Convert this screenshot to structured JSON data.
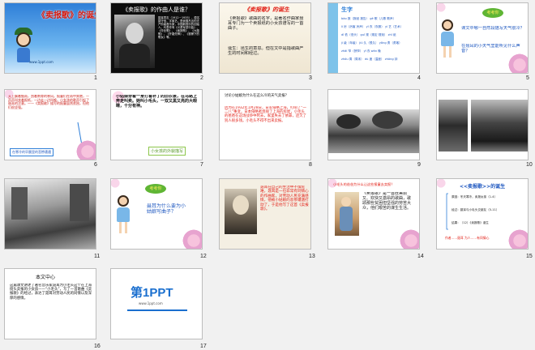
{
  "slides": [
    {
      "number": "1",
      "title": "《卖报歌》的诞生",
      "footer": "www.1ppt.com"
    },
    {
      "number": "2",
      "title": "《卖报歌》的作曲人是谁？",
      "text": "聂耳同志（1912－1935），原名聂守信，字紫艺。是我国杰出的无产阶级音乐家，中国新音乐的创始人。代表作有《义勇军进行曲》、《毕业歌》、《卖报歌》、《大路歌》、《开路先锋》、《铁蹄下的歌女》等。"
    },
    {
      "number": "3",
      "title": "《卖报歌》的诞生",
      "lines": [
        "《卖报歌》歌曲的名字，是著名作曲家聂耳专门为一个卖报纸的小女孩谱写的一首曲子。",
        "诞生：出生的意思。但在文中是指歌曲产生的时间和经过。"
      ]
    },
    {
      "number": "4",
      "title": "生字",
      "rows": [
        "bào 报（报纸 报告）  gē 歌（儿歌 歌声）",
        "lì 厉（厉害 厉声）  yī 衣（衣服）  yì 艺（艺术）",
        "dī 低（低头）  guī 规（规定 规矩）  zhǐ 纸",
        "jí 级（年级）  jiǔ 久（很久）  yǒng 勇（勇敢）",
        "zhāi 窄（狭窄）  yī 衣  wǎn 晚",
        "zhōu 周（周末）  dù 度（温度）  zhōng 钟"
      ]
    },
    {
      "number": "5",
      "bubble": "考考你",
      "lines": [
        "课文中哪一自然段描写天气很冷？",
        "在聂耳的小天气里能听见什么声音？"
      ]
    },
    {
      "number": "6",
      "text": "天上飘着细雨，刮着刺骨的寒风。报童们在雨中奔跑，一声声叫卖着报纸，一边走一边叫唤。小女孩的歌声引起了聂耳的注意。——《卖报歌》描写的报童虽然贫困，但他们很坚强。",
      "footer": "在寒冷的早晨里的悲惨遭遇"
    },
    {
      "number": "7",
      "text": "小姑娘穿着一身打着补丁的旧衣裳，在马路上奔走叫卖。她叫小毛头，一双又黑又亮的大眼睛，十分有神。",
      "footer": "小女孩的外貌描写"
    },
    {
      "number": "8",
      "question": "讨论小姑娘为什么在这么冷的天气卖报？",
      "text": "因为在1932年1月28日，日军侵略上海，打响了“一二八”事变，日本侵略者烧毁了上海的房屋，小毛头的爸爸在这场战争中死去，家里失去了依靠，还欠了别人很多钱。小毛头不得不出来卖报。"
    },
    {
      "number": "9"
    },
    {
      "number": "10"
    },
    {
      "number": "11"
    },
    {
      "number": "12",
      "bubble": "考考你",
      "text": "聂耳为什么要为小姑娘写曲子？"
    },
    {
      "number": "13",
      "text": "聂耳在自己的生活中不惧危难，聂耳是一位非常有同情心的作曲家，对劳动人民充满感情，他被小姑娘的悲惨遭遇打动了，于是他写了这首《卖报歌》。"
    },
    {
      "number": "14",
      "question": "小毛头的爸爸为什么让这些报童去卖报？",
      "text": "《卖报歌》是一首既美丽又、欢快又激昂的歌曲，歌颂那些贫困但坚强的劳苦大众，他们艰苦的谋生生活。"
    },
    {
      "number": "15",
      "title": "<<卖报歌>>的诞生",
      "rows": [
        "原因：冬天寒冷，卖报女孩（1-4）",
        "经过：聂耳与小毛头交朋友（5-11）",
        "结果：（12）《卖报歌》诞生",
        "作者……聂耳  为人……有同情心"
      ]
    },
    {
      "number": "16",
      "title": "本文中心",
      "text": "这篇课文讲述了著名音乐家聂耳为小毛头这个在上海街头卖报的小女孩——“小毛头”，写了一首歌曲《卖报歌》的经过，表达了聂耳对劳动人民的同情以及深厚的感情。"
    },
    {
      "number": "17",
      "logo_text": "第1PPT",
      "logo_sub": "www.1ppt.com"
    }
  ],
  "colors": {
    "red": "#e2231a",
    "blue": "#2f7fd8",
    "green": "#5fb534"
  }
}
